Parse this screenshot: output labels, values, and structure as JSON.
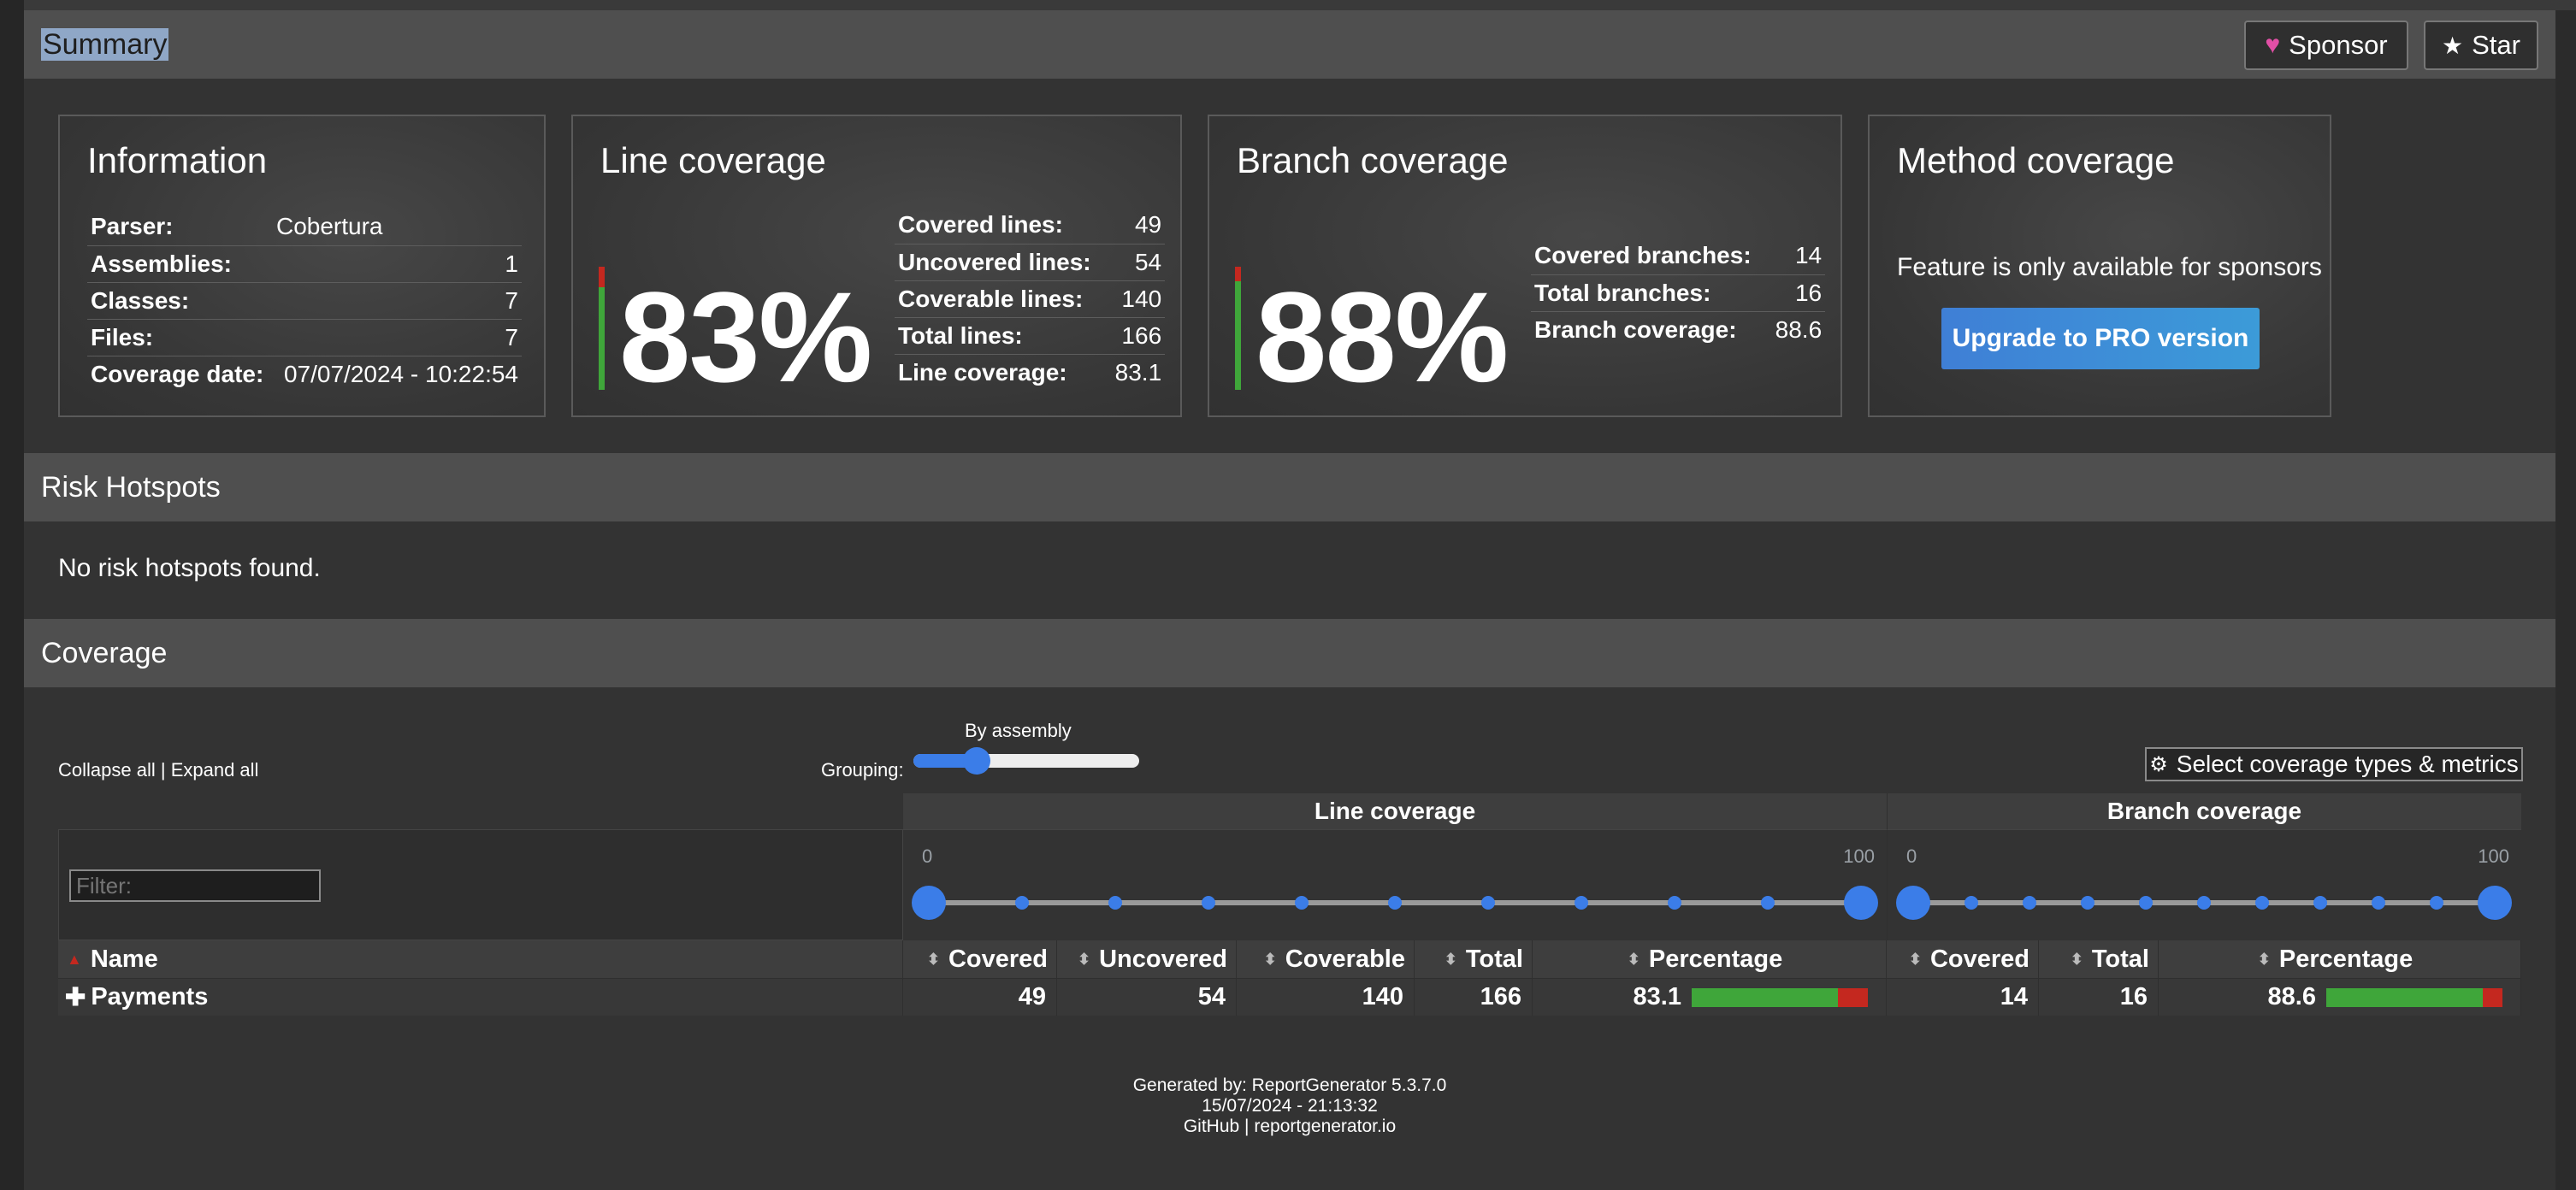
{
  "summary": {
    "title": "Summary",
    "sponsor_label": "Sponsor",
    "star_label": "Star"
  },
  "information": {
    "title": "Information",
    "rows": [
      {
        "key": "Parser:",
        "value": "Cobertura"
      },
      {
        "key": "Assemblies:",
        "value": "1"
      },
      {
        "key": "Classes:",
        "value": "7"
      },
      {
        "key": "Files:",
        "value": "7"
      },
      {
        "key": "Coverage date:",
        "value": "07/07/2024 - 10:22:54"
      }
    ]
  },
  "line_coverage": {
    "title": "Line coverage",
    "percent_label": "83%",
    "percent": 83,
    "rows": [
      {
        "key": "Covered lines:",
        "value": "49"
      },
      {
        "key": "Uncovered lines:",
        "value": "54"
      },
      {
        "key": "Coverable lines:",
        "value": "140"
      },
      {
        "key": "Total lines:",
        "value": "166"
      },
      {
        "key": "Line coverage:",
        "value": "83.1"
      }
    ]
  },
  "branch_coverage": {
    "title": "Branch coverage",
    "percent_label": "88%",
    "percent": 88,
    "rows": [
      {
        "key": "Covered branches:",
        "value": "14"
      },
      {
        "key": "Total branches:",
        "value": "16"
      },
      {
        "key": "Branch coverage:",
        "value": "88.6"
      }
    ]
  },
  "method_coverage": {
    "title": "Method coverage",
    "message": "Feature is only available for sponsors",
    "button": "Upgrade to PRO version"
  },
  "risk_hotspots": {
    "title": "Risk Hotspots",
    "message": "No risk hotspots found."
  },
  "coverage": {
    "title": "Coverage",
    "collapse_label": "Collapse all",
    "separator": "|",
    "expand_label": "Expand all",
    "grouping_label": "Grouping:",
    "grouping_value": "By assembly",
    "grouping_level": 0.25,
    "select_metrics_label": "Select coverage types & metrics",
    "filter_placeholder": "Filter:",
    "line_group": "Line coverage",
    "branch_group": "Branch coverage",
    "range_min": "0",
    "range_max": "100",
    "columns": {
      "name": "Name",
      "covered": "Covered",
      "uncovered": "Uncovered",
      "coverable": "Coverable",
      "total": "Total",
      "percentage": "Percentage",
      "b_covered": "Covered",
      "b_total": "Total",
      "b_percentage": "Percentage"
    },
    "rows": [
      {
        "name": "Payments",
        "covered": "49",
        "uncovered": "54",
        "coverable": "140",
        "total": "166",
        "percentage": "83.1",
        "line_fraction": 0.831,
        "b_covered": "14",
        "b_total": "16",
        "b_percentage": "88.6",
        "branch_fraction": 0.886
      }
    ]
  },
  "footer": {
    "generated": "Generated by: ReportGenerator 5.3.7.0",
    "datetime": "15/07/2024 - 21:13:32",
    "github": "GitHub",
    "separator": "|",
    "site": "reportgenerator.io"
  },
  "colors": {
    "covered": "#3fa63a",
    "uncovered": "#c4281f",
    "accent": "#3b7de8",
    "sponsor_heart": "#e24fa6"
  }
}
